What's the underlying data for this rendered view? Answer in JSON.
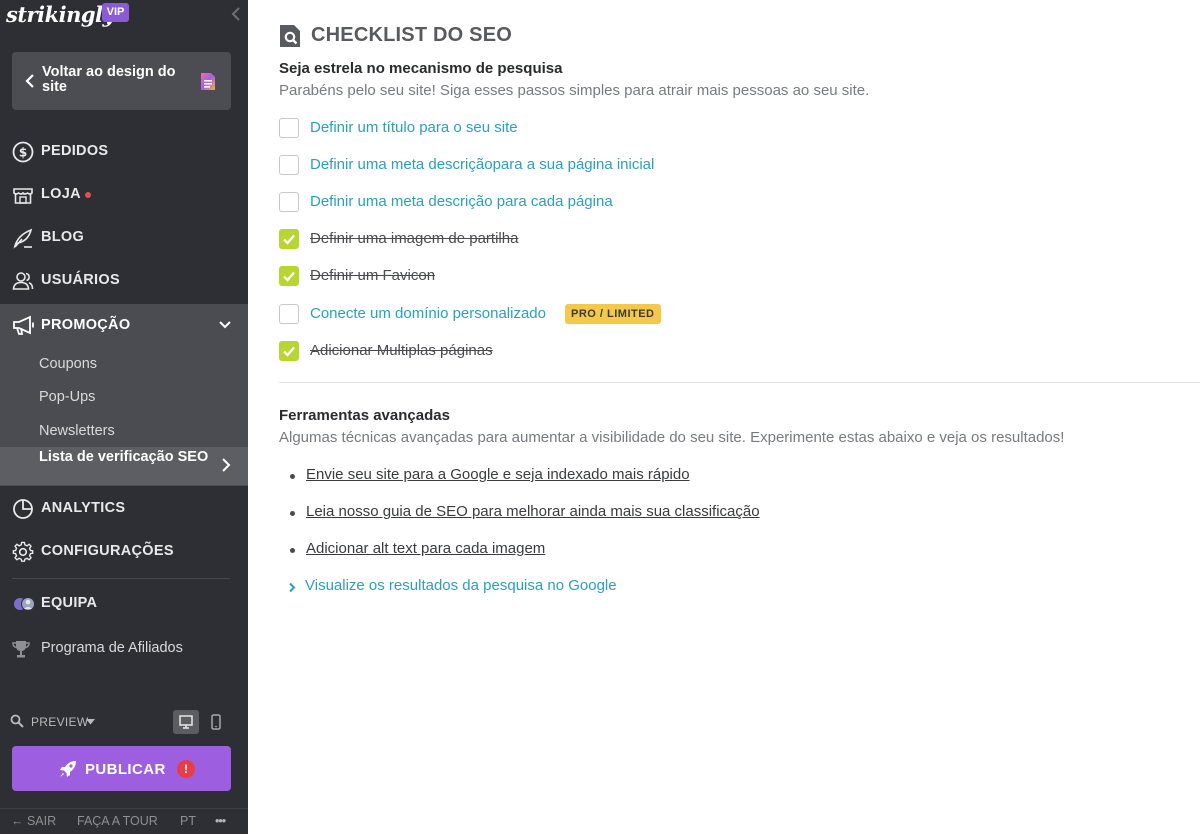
{
  "sidebar": {
    "brand": "strikingly",
    "vip": "VIP",
    "back_label": "Voltar ao design do site",
    "nav": {
      "pedidos": "PEDIDOS",
      "loja": "LOJA",
      "blog": "BLOG",
      "usuarios": "USUÁRIOS",
      "promocao": "PROMOÇÃO",
      "analytics": "ANALYTICS",
      "configuracoes": "CONFIGURAÇÕES",
      "equipa": "EQUIPA"
    },
    "promo_sub": {
      "coupons": "Coupons",
      "popups": "Pop-Ups",
      "newsletters": "Newsletters",
      "seo_checklist": "Lista de verificação SEO"
    },
    "affiliate": "Programa de Afiliados",
    "preview": "PREVIEW",
    "publish": "PUBLICAR",
    "publish_alert": "!",
    "footer": {
      "exit": "← SAIR",
      "tour": "FAÇA A TOUR",
      "lang": "PT",
      "more": "•••"
    }
  },
  "main": {
    "title": "CHECKLIST DO SEO",
    "seo": {
      "heading": "Seja estrela no mecanismo de pesquisa",
      "subtitle": "Parabéns pelo seu site! Siga esses passos simples para atrair mais pessoas ao seu site.",
      "items": [
        {
          "label": "Definir um título para o seu site",
          "done": false
        },
        {
          "label": "Definir uma meta descriçãopara a sua página inicial",
          "done": false
        },
        {
          "label": "Definir uma meta descrição para cada página",
          "done": false
        },
        {
          "label": "Definir uma imagem de partilha",
          "done": true
        },
        {
          "label": "Definir um Favicon",
          "done": true
        },
        {
          "label": "Conecte um domínio personalizado",
          "done": false,
          "badge": "PRO / LIMITED"
        },
        {
          "label": "Adicionar Multiplas páginas",
          "done": true
        }
      ]
    },
    "advanced": {
      "heading": "Ferramentas avançadas",
      "subtitle": "Algumas técnicas avançadas para aumentar a visibilidade do seu site. Experimente estas abaixo e veja os resultados!",
      "links": [
        "Envie seu site para a Google e seja indexado mais rápido",
        "Leia nosso guia de SEO para melhorar ainda mais sua classificação",
        "Adicionar alt text para cada imagem"
      ],
      "google_preview": "Visualize os resultados da pesquisa no Google"
    }
  },
  "colors": {
    "sidebar_bg": "#2e2f34",
    "accent_purple": "#9d5fe0",
    "check_green": "#b7d62f",
    "link_blue": "#2b9fc1",
    "badge_yellow": "#f4c94a"
  }
}
